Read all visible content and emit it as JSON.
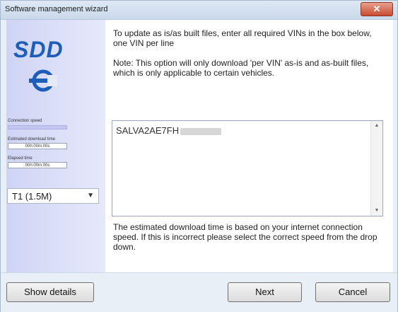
{
  "window": {
    "title": "Software management wizard",
    "close_symbol": "✕"
  },
  "sidebar": {
    "logo_text": "SDD",
    "connection_speed_label": "Connection speed",
    "estimated_download_time_label": "Estimated download time",
    "estimated_download_time_value": "00h:00m:00s",
    "elapsed_time_label": "Elapsed time",
    "elapsed_time_value": "00h:00m:00s",
    "speed_select_value": "T1 (1.5M)"
  },
  "content": {
    "instructions": "To update as is/as built files, enter all required VINs in the box below, one VIN per line",
    "note": "Note: This option will only download 'per VIN' as-is and as-built files, which is only applicable to certain vehicles.",
    "vin_value": "SALVA2AE7FH",
    "download_info": "The estimated download time is based on your internet connection speed. If this is incorrect please select the correct speed from the drop down."
  },
  "footer": {
    "show_details_label": "Show details",
    "next_label": "Next",
    "cancel_label": "Cancel"
  },
  "colors": {
    "logo_blue": "#1e5db8",
    "sidebar_start": "#cfd4f5",
    "close_red": "#c84b31"
  }
}
